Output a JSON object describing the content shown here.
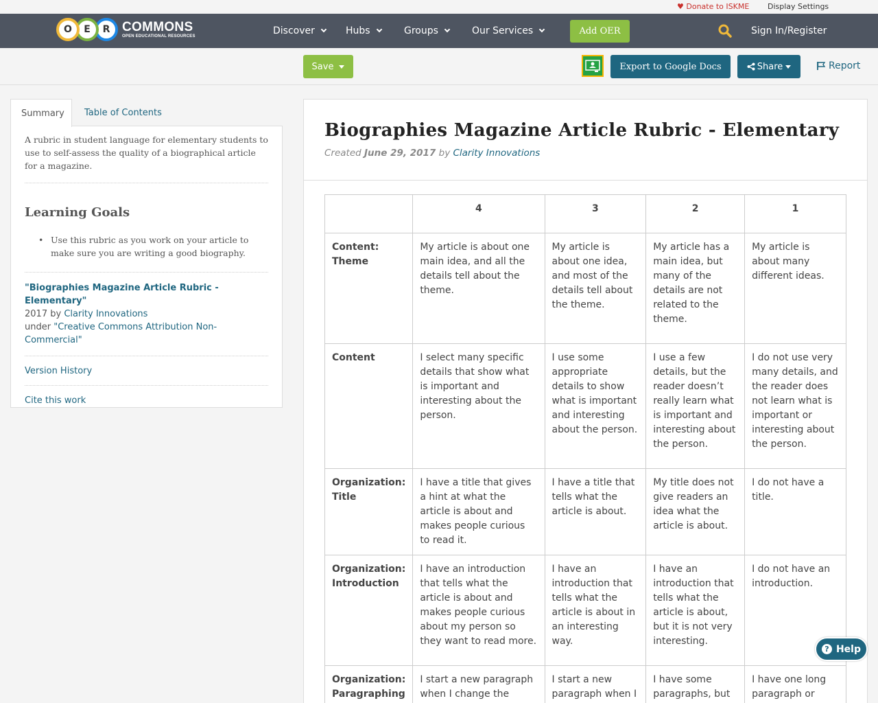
{
  "utility": {
    "donate": "Donate to ISKME",
    "display_settings": "Display Settings"
  },
  "logo": {
    "letters": [
      "O",
      "E",
      "R"
    ],
    "name": "COMMONS",
    "tagline": "OPEN EDUCATIONAL RESOURCES"
  },
  "nav": {
    "items": [
      {
        "label": "Discover"
      },
      {
        "label": "Hubs"
      },
      {
        "label": "Groups"
      },
      {
        "label": "Our Services"
      }
    ],
    "add_oer": "Add OER",
    "sign_in": "Sign In/Register",
    "search_icon": "search-icon",
    "accent": "#8dbf44"
  },
  "toolbar": {
    "save": "Save",
    "export": "Export to Google Docs",
    "share": "Share",
    "report": "Report",
    "button_color": "#1f6680"
  },
  "sidebar": {
    "tabs": [
      "Summary",
      "Table of Contents"
    ],
    "summary": "A rubric in student language for elementary students to use to self-assess the quality of a biographical article for a magazine.",
    "goals_title": "Learning Goals",
    "goals": [
      "Use this rubric as you work on your article to make sure you are writing a good biography."
    ],
    "attribution": {
      "title": "\"Biographies Magazine Article Rubric - Elementary\"",
      "year_by": "2017 by",
      "author": "Clarity Innovations",
      "under": "under",
      "license": "\"Creative Commons Attribution Non-Commercial\""
    },
    "version_history": "Version History",
    "cite": "Cite this work"
  },
  "main": {
    "title": "Biographies Magazine Article Rubric - Elementary",
    "created_label": "Created",
    "date": "June 29, 2017",
    "by_label": "by",
    "author": "Clarity Innovations"
  },
  "rubric": {
    "headers": [
      "",
      "4",
      "3",
      "2",
      "1"
    ],
    "rows": [
      {
        "criterion": "Content: Theme",
        "cells": [
          "My article is about one main idea, and all the details tell about the theme.",
          "My article is about one idea, and most of the details tell about the theme.",
          "My article has a main idea, but many of the details are not related to the theme.",
          "My article is about many different ideas."
        ]
      },
      {
        "criterion": "Content",
        "cells": [
          "I select many specific details that show what is important and interesting about the person.",
          "I use some appropriate details to show what is important and interesting about the person.",
          "I use a few details, but the reader doesn’t really learn what is important and interesting about the person.",
          "I do not use very many details, and the reader does not learn what is important or interesting about the person."
        ]
      },
      {
        "criterion": "Organization: Title",
        "cells": [
          "I have a title that gives a hint at what the article is about and makes people curious to read it.",
          "I have a title that tells what the article is about.",
          "My title does not give readers an idea what the article is about.",
          "I do not have a title."
        ]
      },
      {
        "criterion": "Organization: Introduction",
        "cells": [
          "I have an introduction that tells what the article is about and makes people curious about my person so they want to read more.",
          "I have an introduction that tells what the article is about in an interesting way.",
          "I have an introduction that tells what the article is about, but it is not very interesting.",
          "I do not have an introduction."
        ]
      },
      {
        "criterion": "Organization: Paragraphing",
        "cells": [
          "I start a new paragraph when I change the subject and when the speaker",
          "I start a new paragraph when I change the",
          "I have some paragraphs, but there may be too",
          "I have one long paragraph or many really short"
        ]
      }
    ]
  },
  "help": "Help"
}
